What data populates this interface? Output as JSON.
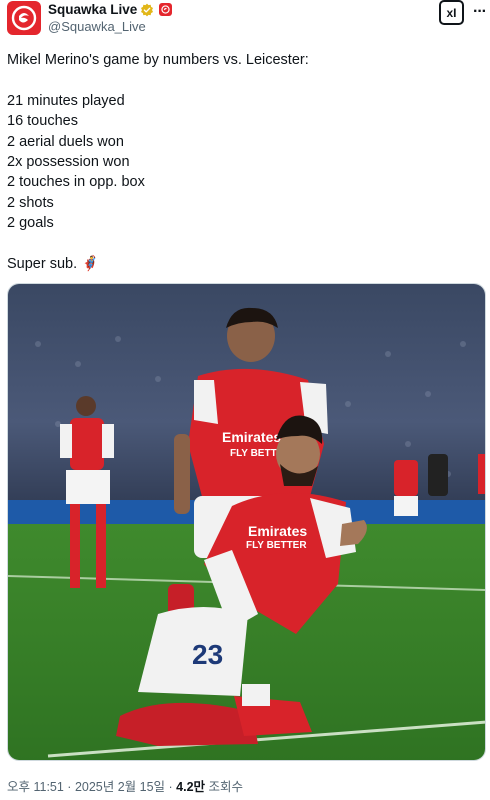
{
  "author": {
    "display_name": "Squawka Live",
    "handle": "@Squawka_Live",
    "avatar_icon": "squawka-logo",
    "brand_color": "#e4262d"
  },
  "actions": {
    "grok_label": "xI",
    "more_label": "···"
  },
  "tweet": {
    "lines": [
      "Mikel Merino's game by numbers vs. Leicester:",
      "",
      "21 minutes played",
      "16 touches",
      "2 aerial duels won",
      "2x possession won",
      "2 touches in opp. box",
      "2 shots",
      "2 goals",
      "",
      "Super sub. 🦸‍♂️"
    ]
  },
  "media": {
    "type": "photo",
    "subject": "football-celebration",
    "shirt_text": "Emirates FLY BETTER",
    "shirt_number": "23"
  },
  "meta": {
    "time": "오후 11:51",
    "separator": " · ",
    "date": "2025년 2월 15일",
    "views_count": "4.2만",
    "views_label": " 조회수"
  }
}
